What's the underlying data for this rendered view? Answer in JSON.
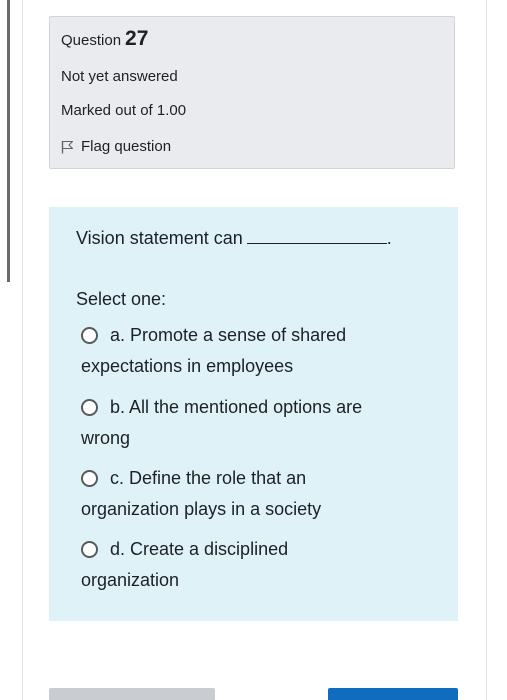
{
  "question_info": {
    "label": "Question",
    "number": "27",
    "state": "Not yet answered",
    "grade": "Marked out of 1.00",
    "flag_label": "Flag question"
  },
  "question": {
    "text": "Vision statement can",
    "trailing": ".",
    "prompt": "Select one:",
    "options": [
      {
        "line1": "a. Promote a sense of shared",
        "line2": "expectations in employees"
      },
      {
        "line1": "b. All the mentioned options are",
        "line2": "wrong"
      },
      {
        "line1": "c. Define the role that an",
        "line2": "organization plays in a society"
      },
      {
        "line1": "d. Create a disciplined",
        "line2": "organization"
      }
    ]
  },
  "colors": {
    "info_bg": "#e9ebee",
    "content_bg": "#def2f8",
    "primary_button": "#0f6cbf"
  }
}
